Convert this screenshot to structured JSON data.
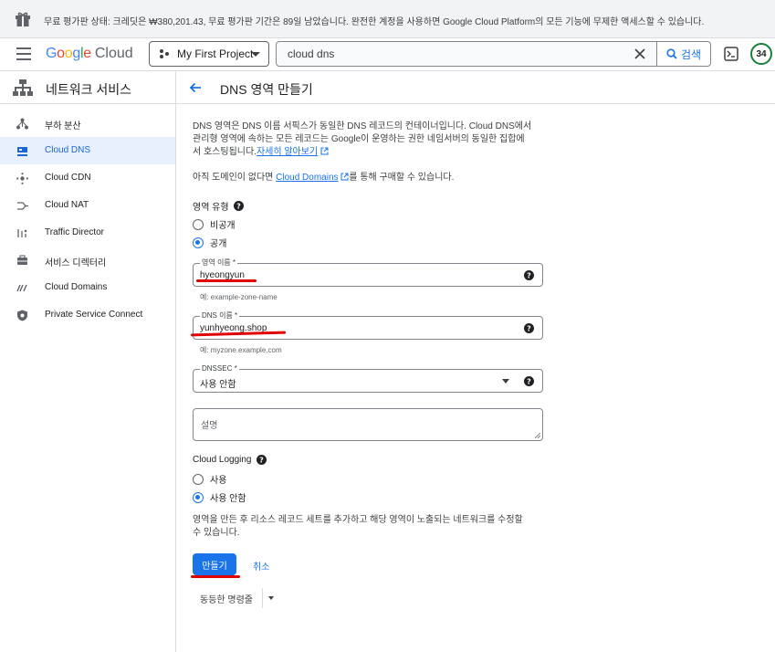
{
  "banner": {
    "text": "무료 평가판 상태: 크레딧은 ₩380,201.43, 무료 평가판 기간은 89일 남았습니다. 완전한 계정을 사용하면 Google Cloud Platform의 모든 기능에 무제한 액세스할 수 있습니다."
  },
  "topbar": {
    "logo_google": "Google",
    "logo_cloud": "Cloud",
    "project": "My First Project",
    "search_value": "cloud dns",
    "search_button": "검색",
    "avatar": "34"
  },
  "sidebar": {
    "title": "네트워크 서비스",
    "items": [
      {
        "label": "부하 분산",
        "icon": "load-balancing-icon"
      },
      {
        "label": "Cloud DNS",
        "icon": "dns-icon",
        "active": true
      },
      {
        "label": "Cloud CDN",
        "icon": "cdn-icon"
      },
      {
        "label": "Cloud NAT",
        "icon": "nat-icon"
      },
      {
        "label": "Traffic Director",
        "icon": "traffic-director-icon"
      },
      {
        "label": "서비스 디렉터리",
        "icon": "service-directory-icon"
      },
      {
        "label": "Cloud Domains",
        "icon": "domains-icon"
      },
      {
        "label": "Private Service Connect",
        "icon": "private-service-connect-icon"
      }
    ]
  },
  "page": {
    "title": "DNS 영역 만들기",
    "desc_line1": "DNS 영역은 DNS 이름 서픽스가 동일한 DNS 레코드의 컨테이너입니다. Cloud DNS에서",
    "desc_line2": "관리형 영역에 속하는 모든 레코드는 Google이 운영하는 권한 네임서버의 동일한 집합에",
    "desc_line3a": "서 호스팅됩니다.",
    "learn_more": "자세히 알아보기",
    "domain_prefix": "아직 도메인이 없다면 ",
    "cloud_domains_link": "Cloud Domains",
    "domain_suffix": "를 통해 구매할 수 있습니다.",
    "zone_type_label": "영역 유형",
    "zone_private": "비공개",
    "zone_public": "공개",
    "zone_selected": "공개",
    "zone_name_label": "영역 이름 *",
    "zone_name_value": "hyeongyun",
    "zone_name_hint": "예: example-zone-name",
    "dns_name_label": "DNS 이름 *",
    "dns_name_value": "yunhyeong.shop",
    "dns_name_hint": "예: myzone.example.com",
    "dnssec_label": "DNSSEC *",
    "dnssec_value": "사용 안함",
    "description_placeholder": "설명",
    "logging_label": "Cloud Logging",
    "logging_on": "사용",
    "logging_off": "사용 안함",
    "logging_selected": "사용 안함",
    "note_line1": "영역을 만든 후 리소스 레코드 세트를 추가하고 해당 영역이 노출되는 네트워크를 수정할",
    "note_line2": "수 있습니다.",
    "create": "만들기",
    "cancel": "취소",
    "equivalent": "동등한 명령줄"
  },
  "colors": {
    "accent": "#1a73e8",
    "active_bg": "#e8f0fe",
    "annotation": "#e00000"
  }
}
